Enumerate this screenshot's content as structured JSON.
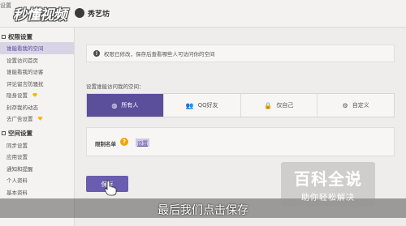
{
  "header": {
    "top_tab": "设置",
    "logo": "秒懂视频",
    "brand": "秀艺坊"
  },
  "sidebar": {
    "sections": [
      {
        "title": "权限设置",
        "items": [
          {
            "label": "谁能看我的空间",
            "active": true,
            "gem": false
          },
          {
            "label": "设置访问首页",
            "active": false,
            "gem": false
          },
          {
            "label": "谁能看我的访客",
            "active": false,
            "gem": false
          },
          {
            "label": "评论留言防骚扰",
            "active": false,
            "gem": false
          },
          {
            "label": "隐身设置",
            "active": false,
            "gem": true
          },
          {
            "label": "封存我的动态",
            "active": false,
            "gem": false
          },
          {
            "label": "去广告设置",
            "active": false,
            "gem": true
          }
        ]
      },
      {
        "title": "空间设置",
        "items": [
          {
            "label": "同步设置",
            "active": false,
            "gem": false
          },
          {
            "label": "应用设置",
            "active": false,
            "gem": false
          },
          {
            "label": "通知和提醒",
            "active": false,
            "gem": false
          },
          {
            "label": "个人资料",
            "active": false,
            "gem": false
          },
          {
            "label": "基本资料",
            "active": false,
            "gem": false
          }
        ]
      }
    ]
  },
  "main": {
    "notice": "权限已修改，保存后查看哪些人可访问你的空间",
    "question": "设置谁能访问我的空间：",
    "options": [
      {
        "label": "所有人",
        "icon": "globe-icon",
        "glyph": "◍",
        "selected": true
      },
      {
        "label": "QQ好友",
        "icon": "friends-icon",
        "glyph": "👥",
        "selected": false
      },
      {
        "label": "仅自己",
        "icon": "lock-icon",
        "glyph": "🔒",
        "selected": false
      },
      {
        "label": "自定义",
        "icon": "gear-icon",
        "glyph": "⚙",
        "selected": false
      }
    ],
    "limit_label": "限制名单",
    "limit_link": "设置",
    "save_button": "保存"
  },
  "subtitle": "最后我们点击保存",
  "watermark": {
    "title": "百科全说",
    "subtitle": "助你轻松解决"
  },
  "colors": {
    "accent": "#5b4f9c",
    "warning": "#f0a600"
  }
}
